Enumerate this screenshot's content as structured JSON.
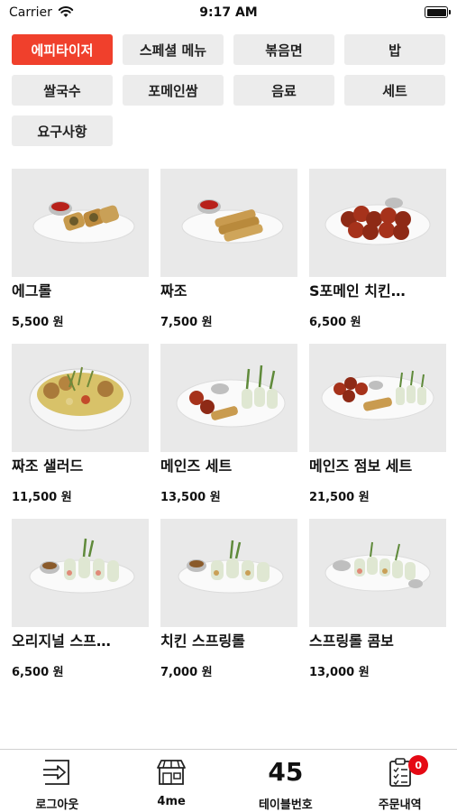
{
  "status_bar": {
    "carrier": "Carrier",
    "time": "9:17 AM"
  },
  "categories": [
    {
      "label": "에피타이저",
      "active": true
    },
    {
      "label": "스페셜 메뉴",
      "active": false
    },
    {
      "label": "볶음면",
      "active": false
    },
    {
      "label": "밥",
      "active": false
    },
    {
      "label": "쌀국수",
      "active": false
    },
    {
      "label": "포메인쌈",
      "active": false
    },
    {
      "label": "음료",
      "active": false
    },
    {
      "label": "세트",
      "active": false
    },
    {
      "label": "요구사항",
      "active": false
    }
  ],
  "products": [
    {
      "name": "에그롤",
      "price": "5,500 원",
      "image": "egg-roll-photo"
    },
    {
      "name": "짜조",
      "price": "7,500 원",
      "image": "fried-spring-roll-photo"
    },
    {
      "name": "S포메인 치킨…",
      "price": "6,500 원",
      "image": "fried-chicken-photo"
    },
    {
      "name": "짜조 샐러드",
      "price": "11,500 원",
      "image": "salad-bowl-photo"
    },
    {
      "name": "메인즈 세트",
      "price": "13,500 원",
      "image": "mains-set-photo"
    },
    {
      "name": "메인즈 점보 세트",
      "price": "21,500 원",
      "image": "mains-jumbo-set-photo"
    },
    {
      "name": "오리지널 스프…",
      "price": "6,500 원",
      "image": "original-spring-roll-photo"
    },
    {
      "name": "치킨 스프링롤",
      "price": "7,000 원",
      "image": "chicken-spring-roll-photo"
    },
    {
      "name": "스프링롤 콤보",
      "price": "13,000 원",
      "image": "spring-roll-combo-photo"
    }
  ],
  "tab_bar": {
    "logout": {
      "label": "로그아웃",
      "icon": "logout-icon"
    },
    "store": {
      "label": "4me",
      "icon": "store-icon"
    },
    "table": {
      "label": "테이블번호",
      "number": "45"
    },
    "orders": {
      "label": "주문내역",
      "icon": "clipboard-icon",
      "badge": "0"
    }
  },
  "colors": {
    "accent": "#f0402c",
    "chip": "#ececec",
    "badge": "#e50914"
  }
}
